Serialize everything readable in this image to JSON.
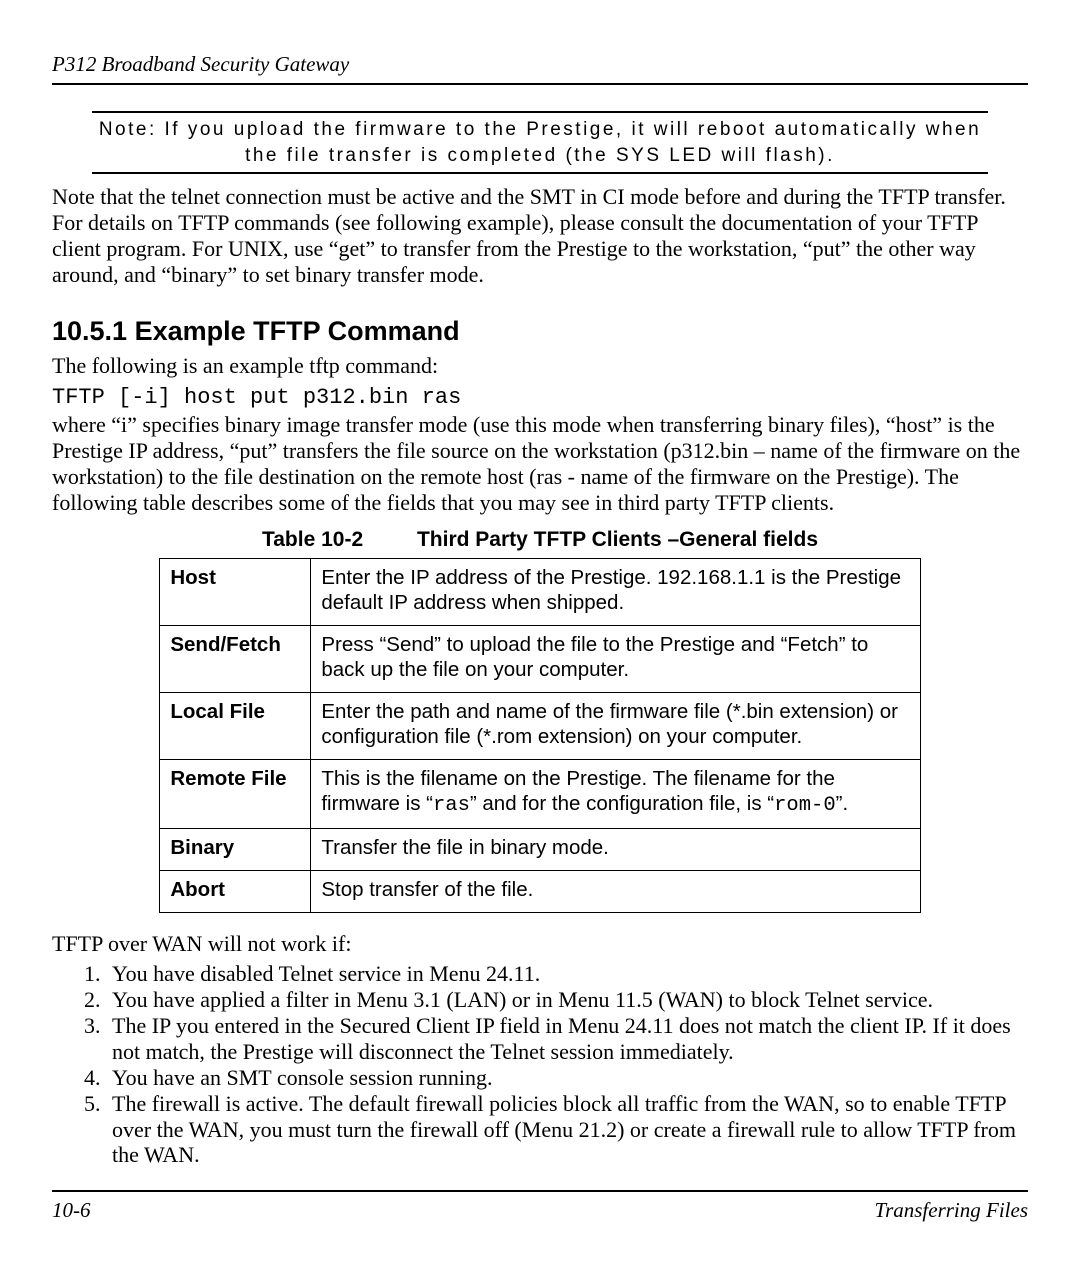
{
  "header": "P312  Broadband Security Gateway",
  "note": "Note: If you upload the firmware to the Prestige, it will reboot automatically when the file transfer is completed (the SYS LED will flash).",
  "intro": "Note that the telnet connection must be active and the SMT in CI mode before and during the TFTP transfer. For details on TFTP commands (see following example), please consult the documentation of your TFTP client program. For UNIX, use “get” to transfer from the Prestige to the workstation, “put” the other way around, and “binary” to set binary transfer mode.",
  "section_heading": "10.5.1 Example TFTP Command",
  "section_intro": "The following is an example tftp command:",
  "code": "TFTP [-i] host put p312.bin ras",
  "after_code": "where “i” specifies binary image transfer mode (use this mode when transferring binary files), “host” is the Prestige IP address, “put” transfers the file source on the workstation (p312.bin – name of the firmware on the workstation) to the file destination on the remote host (ras - name of the firmware on the Prestige). The following table describes some of the fields that you may see in third party TFTP clients.",
  "table_caption_left": "Table 10-2",
  "table_caption_right": "Third Party TFTP Clients –General fields",
  "table": {
    "rows": [
      {
        "field": "Host",
        "desc": "Enter the IP address of the Prestige. 192.168.1.1 is the Prestige default IP address when shipped."
      },
      {
        "field": "Send/Fetch",
        "desc": "Press “Send” to upload the file to the Prestige and “Fetch” to back up the file on your computer."
      },
      {
        "field": "Local File",
        "desc": "Enter the path and name of the firmware file (*.bin extension) or configuration file (*.rom extension) on your computer."
      },
      {
        "field": "Remote File",
        "desc_pre": "This is the filename on the Prestige. The filename for the firmware is “",
        "mono1": "ras",
        "desc_mid": "” and for the configuration file, is “",
        "mono2": "rom-0",
        "desc_post": "”."
      },
      {
        "field": "Binary",
        "desc": "Transfer the file in binary mode."
      },
      {
        "field": "Abort",
        "desc": "Stop transfer of the file."
      }
    ]
  },
  "wan_intro": "TFTP over WAN will not work if:",
  "wan_items": [
    "You have disabled Telnet service in Menu 24.11.",
    "You have applied a filter in Menu 3.1 (LAN) or in Menu 11.5 (WAN) to block Telnet service.",
    "The IP you entered in the Secured Client IP field in Menu 24.11 does not match the client IP. If it does not match, the Prestige will disconnect the Telnet session immediately.",
    "You have an SMT console session running.",
    "The firewall is active. The default firewall policies block all traffic from the WAN, so to enable TFTP over the WAN, you must turn the firewall off (Menu 21.2) or create a firewall rule to allow TFTP from the WAN."
  ],
  "footer_page": "10-6",
  "footer_section": "Transferring Files"
}
